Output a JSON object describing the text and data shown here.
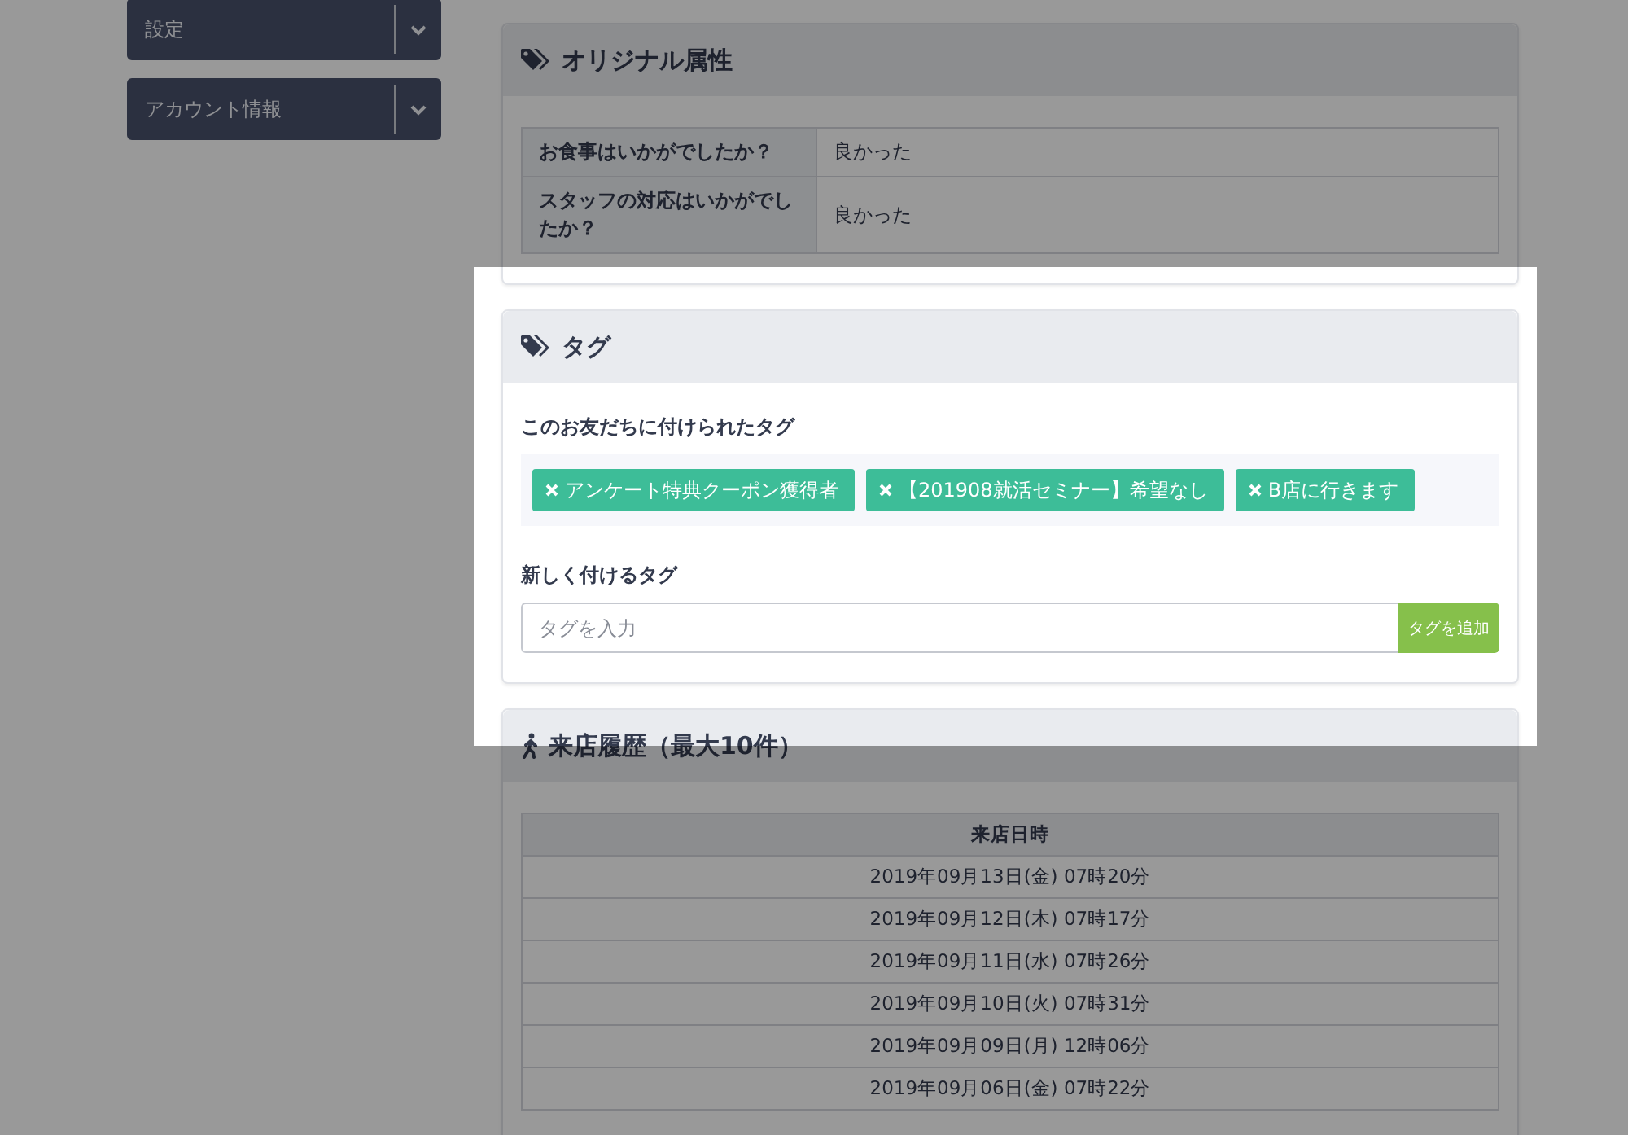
{
  "sidebar": {
    "items": [
      {
        "label": "設定"
      },
      {
        "label": "アカウント情報"
      }
    ]
  },
  "attributes": {
    "title": "オリジナル属性",
    "rows": [
      {
        "question": "お食事はいかがでしたか？",
        "answer": "良かった"
      },
      {
        "question": "スタッフの対応はいかがでしたか？",
        "answer": "良かった"
      }
    ]
  },
  "tags": {
    "title": "タグ",
    "highlighted": true,
    "attached_label": "このお友だちに付けられたタグ",
    "attached": [
      {
        "label": "アンケート特典クーポン獲得者"
      },
      {
        "label": "【201908就活セミナー】希望なし"
      },
      {
        "label": "B店に行きます"
      }
    ],
    "new_label": "新しく付けるタグ",
    "input": {
      "placeholder": "タグを入力"
    },
    "add_button": "タグを追加"
  },
  "visits": {
    "title": "来店履歴（最大10件）",
    "column": "来店日時",
    "rows": [
      "2019年09月13日(金) 07時20分",
      "2019年09月12日(木) 07時17分",
      "2019年09月11日(水) 07時26分",
      "2019年09月10日(火) 07時31分",
      "2019年09月09日(月) 12時06分",
      "2019年09月06日(金) 07時22分"
    ]
  }
}
